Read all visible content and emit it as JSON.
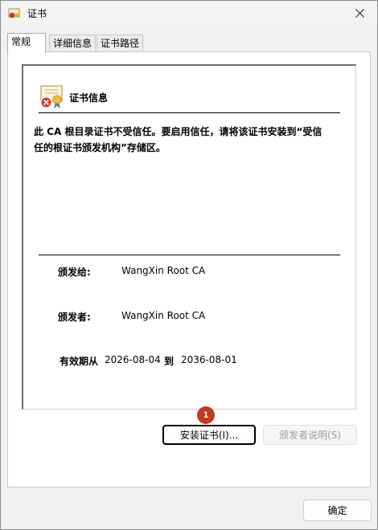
{
  "window": {
    "title": "证书"
  },
  "tabs": [
    {
      "label": "常规",
      "active": true
    },
    {
      "label": "详细信息",
      "active": false
    },
    {
      "label": "证书路径",
      "active": false
    }
  ],
  "cert": {
    "heading": "证书信息",
    "warning": "此 CA 根目录证书不受信任。要启用信任，请将该证书安装到“受信任的根证书颁发机构”存储区。",
    "issued_to_label": "颁发给:",
    "issued_to_value": "WangXin Root CA",
    "issued_by_label": "颁发者:",
    "issued_by_value": "WangXin Root CA",
    "validity_label": "有效期从",
    "valid_from": "2026-08-04",
    "to_label": "到",
    "valid_to": "2036-08-01"
  },
  "buttons": {
    "install": "安装证书(I)...",
    "issuer_statement": "颁发者说明(S)",
    "ok": "确定"
  },
  "badge": "1",
  "colors": {
    "badge": "#c33a21",
    "window_bg": "#f0f0f0"
  }
}
